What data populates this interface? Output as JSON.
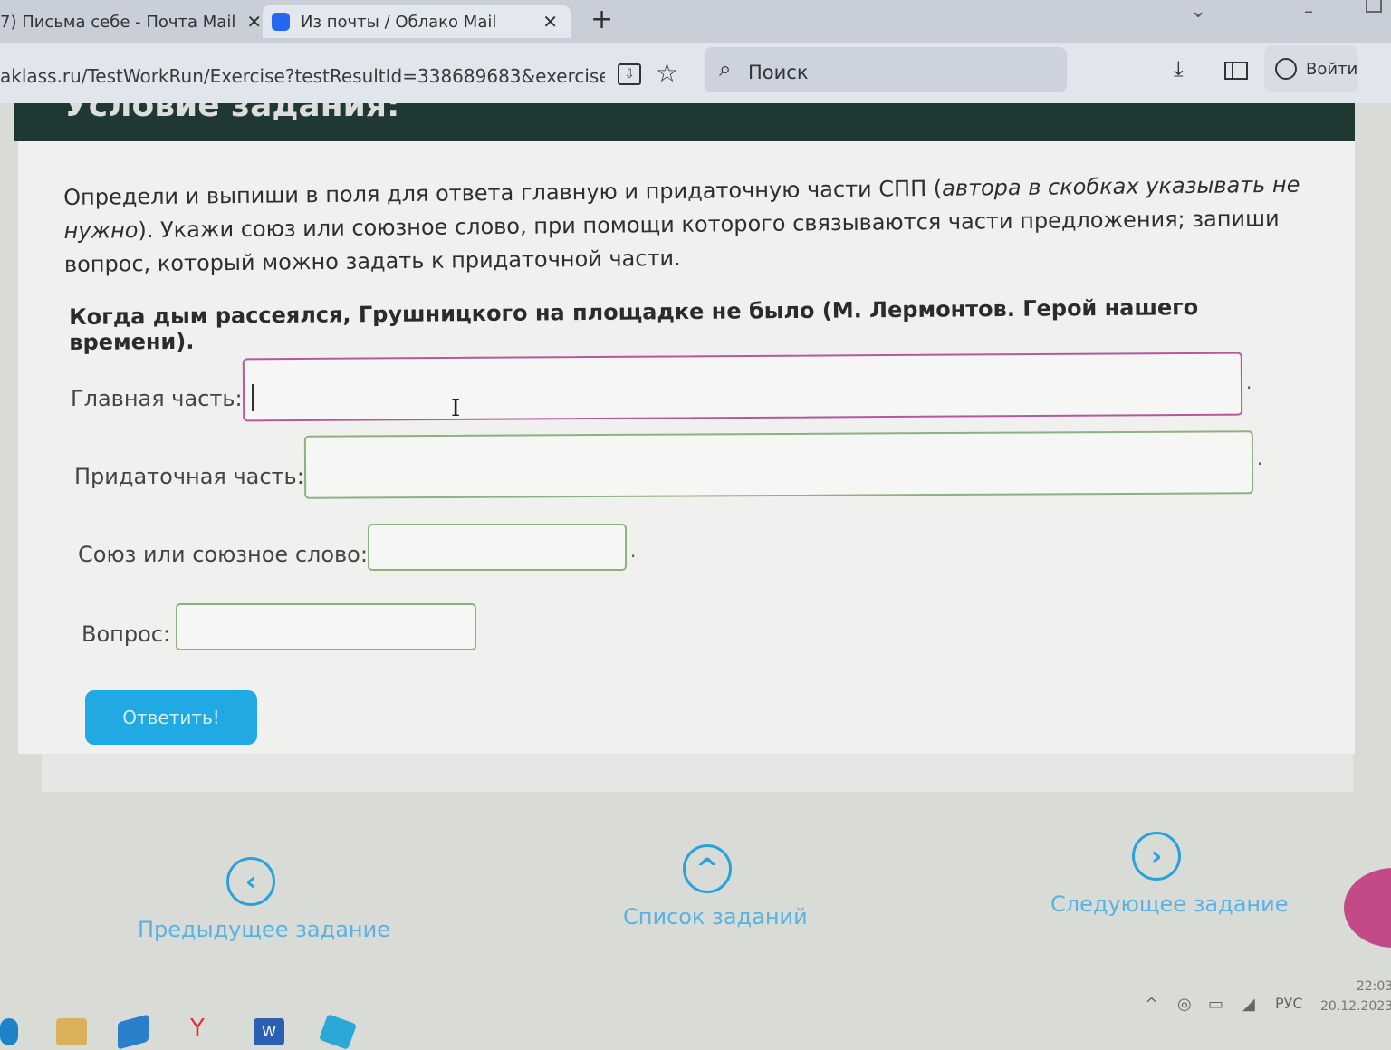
{
  "browser": {
    "tabs": [
      {
        "title": "7) Письма себе - Почта Mail",
        "close": "✕"
      },
      {
        "title": "Из почты / Облако Mail",
        "close": "✕"
      }
    ],
    "new_tab": "+",
    "url": "aklass.ru/TestWorkRun/Exercise?testResultId=338689683&exercisePosi",
    "search_placeholder": "Поиск",
    "login_label": "Войти"
  },
  "page": {
    "section_title": "Условие задания:",
    "instructions_plain_1": "Определи и выпиши в поля для ответа главную и придаточную части СПП (",
    "instructions_italic": "автора в скобках указывать не нужно",
    "instructions_plain_2": "). Укажи союз или союзное слово, при помощи которого связываются части предложения; запиши вопрос, который можно задать к придаточной части.",
    "sentence": "Когда дым рассеялся, Грушницкого на площадке не было (М. Лермонтов. Герой нашего времени).",
    "fields": {
      "main": {
        "label": "Главная часть:",
        "value": ""
      },
      "subordinate": {
        "label": "Придаточная часть:",
        "value": ""
      },
      "conjunction": {
        "label": "Союз или союзное слово:",
        "value": ""
      },
      "question": {
        "label": "Вопрос:",
        "value": ""
      }
    },
    "dot": ".",
    "answer_button": "Ответить!"
  },
  "navigation": {
    "previous": "Предыдущее задание",
    "list": "Список заданий",
    "next": "Следующее задание"
  },
  "taskbar": {
    "language": "РУС",
    "time": "22:03",
    "date": "20.12.2023"
  },
  "colors": {
    "accent": "#20a9e3",
    "nav": "#28a2de",
    "header_band": "#1f3834",
    "field_focus": "#b45a9c",
    "field_border": "#8fb07f"
  }
}
